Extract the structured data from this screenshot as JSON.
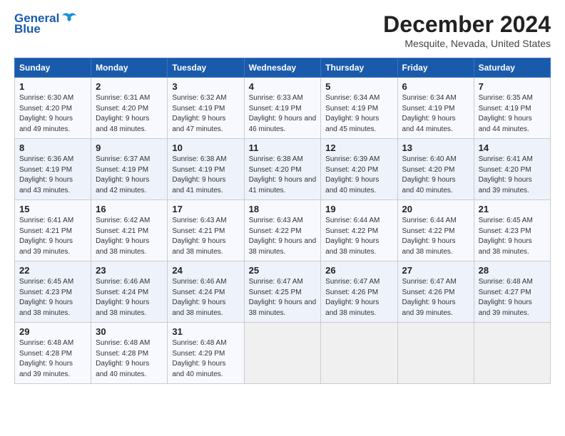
{
  "header": {
    "logo_line1": "General",
    "logo_line2": "Blue",
    "title": "December 2024",
    "subtitle": "Mesquite, Nevada, United States"
  },
  "weekdays": [
    "Sunday",
    "Monday",
    "Tuesday",
    "Wednesday",
    "Thursday",
    "Friday",
    "Saturday"
  ],
  "weeks": [
    [
      {
        "day": "1",
        "sunrise": "Sunrise: 6:30 AM",
        "sunset": "Sunset: 4:20 PM",
        "daylight": "Daylight: 9 hours and 49 minutes."
      },
      {
        "day": "2",
        "sunrise": "Sunrise: 6:31 AM",
        "sunset": "Sunset: 4:20 PM",
        "daylight": "Daylight: 9 hours and 48 minutes."
      },
      {
        "day": "3",
        "sunrise": "Sunrise: 6:32 AM",
        "sunset": "Sunset: 4:19 PM",
        "daylight": "Daylight: 9 hours and 47 minutes."
      },
      {
        "day": "4",
        "sunrise": "Sunrise: 6:33 AM",
        "sunset": "Sunset: 4:19 PM",
        "daylight": "Daylight: 9 hours and 46 minutes."
      },
      {
        "day": "5",
        "sunrise": "Sunrise: 6:34 AM",
        "sunset": "Sunset: 4:19 PM",
        "daylight": "Daylight: 9 hours and 45 minutes."
      },
      {
        "day": "6",
        "sunrise": "Sunrise: 6:34 AM",
        "sunset": "Sunset: 4:19 PM",
        "daylight": "Daylight: 9 hours and 44 minutes."
      },
      {
        "day": "7",
        "sunrise": "Sunrise: 6:35 AM",
        "sunset": "Sunset: 4:19 PM",
        "daylight": "Daylight: 9 hours and 44 minutes."
      }
    ],
    [
      {
        "day": "8",
        "sunrise": "Sunrise: 6:36 AM",
        "sunset": "Sunset: 4:19 PM",
        "daylight": "Daylight: 9 hours and 43 minutes."
      },
      {
        "day": "9",
        "sunrise": "Sunrise: 6:37 AM",
        "sunset": "Sunset: 4:19 PM",
        "daylight": "Daylight: 9 hours and 42 minutes."
      },
      {
        "day": "10",
        "sunrise": "Sunrise: 6:38 AM",
        "sunset": "Sunset: 4:19 PM",
        "daylight": "Daylight: 9 hours and 41 minutes."
      },
      {
        "day": "11",
        "sunrise": "Sunrise: 6:38 AM",
        "sunset": "Sunset: 4:20 PM",
        "daylight": "Daylight: 9 hours and 41 minutes."
      },
      {
        "day": "12",
        "sunrise": "Sunrise: 6:39 AM",
        "sunset": "Sunset: 4:20 PM",
        "daylight": "Daylight: 9 hours and 40 minutes."
      },
      {
        "day": "13",
        "sunrise": "Sunrise: 6:40 AM",
        "sunset": "Sunset: 4:20 PM",
        "daylight": "Daylight: 9 hours and 40 minutes."
      },
      {
        "day": "14",
        "sunrise": "Sunrise: 6:41 AM",
        "sunset": "Sunset: 4:20 PM",
        "daylight": "Daylight: 9 hours and 39 minutes."
      }
    ],
    [
      {
        "day": "15",
        "sunrise": "Sunrise: 6:41 AM",
        "sunset": "Sunset: 4:21 PM",
        "daylight": "Daylight: 9 hours and 39 minutes."
      },
      {
        "day": "16",
        "sunrise": "Sunrise: 6:42 AM",
        "sunset": "Sunset: 4:21 PM",
        "daylight": "Daylight: 9 hours and 38 minutes."
      },
      {
        "day": "17",
        "sunrise": "Sunrise: 6:43 AM",
        "sunset": "Sunset: 4:21 PM",
        "daylight": "Daylight: 9 hours and 38 minutes."
      },
      {
        "day": "18",
        "sunrise": "Sunrise: 6:43 AM",
        "sunset": "Sunset: 4:22 PM",
        "daylight": "Daylight: 9 hours and 38 minutes."
      },
      {
        "day": "19",
        "sunrise": "Sunrise: 6:44 AM",
        "sunset": "Sunset: 4:22 PM",
        "daylight": "Daylight: 9 hours and 38 minutes."
      },
      {
        "day": "20",
        "sunrise": "Sunrise: 6:44 AM",
        "sunset": "Sunset: 4:22 PM",
        "daylight": "Daylight: 9 hours and 38 minutes."
      },
      {
        "day": "21",
        "sunrise": "Sunrise: 6:45 AM",
        "sunset": "Sunset: 4:23 PM",
        "daylight": "Daylight: 9 hours and 38 minutes."
      }
    ],
    [
      {
        "day": "22",
        "sunrise": "Sunrise: 6:45 AM",
        "sunset": "Sunset: 4:23 PM",
        "daylight": "Daylight: 9 hours and 38 minutes."
      },
      {
        "day": "23",
        "sunrise": "Sunrise: 6:46 AM",
        "sunset": "Sunset: 4:24 PM",
        "daylight": "Daylight: 9 hours and 38 minutes."
      },
      {
        "day": "24",
        "sunrise": "Sunrise: 6:46 AM",
        "sunset": "Sunset: 4:24 PM",
        "daylight": "Daylight: 9 hours and 38 minutes."
      },
      {
        "day": "25",
        "sunrise": "Sunrise: 6:47 AM",
        "sunset": "Sunset: 4:25 PM",
        "daylight": "Daylight: 9 hours and 38 minutes."
      },
      {
        "day": "26",
        "sunrise": "Sunrise: 6:47 AM",
        "sunset": "Sunset: 4:26 PM",
        "daylight": "Daylight: 9 hours and 38 minutes."
      },
      {
        "day": "27",
        "sunrise": "Sunrise: 6:47 AM",
        "sunset": "Sunset: 4:26 PM",
        "daylight": "Daylight: 9 hours and 39 minutes."
      },
      {
        "day": "28",
        "sunrise": "Sunrise: 6:48 AM",
        "sunset": "Sunset: 4:27 PM",
        "daylight": "Daylight: 9 hours and 39 minutes."
      }
    ],
    [
      {
        "day": "29",
        "sunrise": "Sunrise: 6:48 AM",
        "sunset": "Sunset: 4:28 PM",
        "daylight": "Daylight: 9 hours and 39 minutes."
      },
      {
        "day": "30",
        "sunrise": "Sunrise: 6:48 AM",
        "sunset": "Sunset: 4:28 PM",
        "daylight": "Daylight: 9 hours and 40 minutes."
      },
      {
        "day": "31",
        "sunrise": "Sunrise: 6:48 AM",
        "sunset": "Sunset: 4:29 PM",
        "daylight": "Daylight: 9 hours and 40 minutes."
      },
      null,
      null,
      null,
      null
    ]
  ]
}
